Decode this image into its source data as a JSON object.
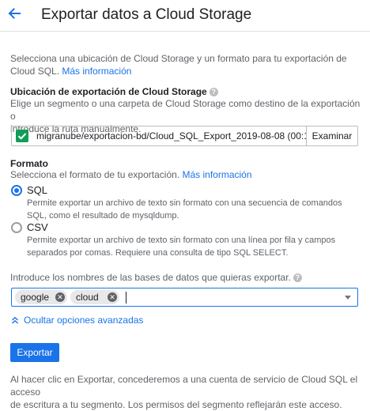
{
  "header": {
    "title": "Exportar datos a Cloud Storage"
  },
  "intro": {
    "text_line1": "Selecciona una ubicación de Cloud Storage y un formato para tu exportación de",
    "text_line2": "Cloud SQL.",
    "link": "Más información"
  },
  "location": {
    "heading": "Ubicación de exportación de Cloud Storage",
    "help_icon": "help-circle-icon",
    "desc_line1": "Elige un segmento o una carpeta de Cloud Storage como destino de la exportación o",
    "desc_line2": "introduce la ruta manualmente.",
    "path_value": "migranube/exportacion-bd/Cloud_SQL_Export_2019-08-08 (00:1",
    "valid_icon": "check-icon",
    "browse_label": "Examinar"
  },
  "format": {
    "heading": "Formato",
    "desc": "Selecciona el formato de tu exportación.",
    "link": "Más información",
    "options": [
      {
        "label": "SQL",
        "selected": true,
        "desc_line1": "Permite exportar un archivo de texto sin formato con una secuencia de comandos",
        "desc_line2": "SQL, como el resultado de mysqldump."
      },
      {
        "label": "CSV",
        "selected": false,
        "desc_line1": "Permite exportar un archivo de texto sin formato con una línea por fila y campos",
        "desc_line2": "separados por comas. Requiere una consulta de tipo SQL SELECT."
      }
    ]
  },
  "databases": {
    "label": "Introduce los nombres de las bases de datos que quieras exportar.",
    "chips": [
      "google",
      "cloud"
    ]
  },
  "advanced": {
    "label": "Ocultar opciones avanzadas"
  },
  "actions": {
    "export_label": "Exportar"
  },
  "footer": {
    "line1": "Al hacer clic en Exportar, concederemos a una cuenta de servicio de Cloud SQL el acceso",
    "line2": "de escritura a tu segmento. Los permisos del segmento reflejarán este acceso."
  },
  "colors": {
    "accent": "#1a73e8",
    "success": "#0f9d58",
    "text": "#202124",
    "muted": "#5f6368"
  }
}
